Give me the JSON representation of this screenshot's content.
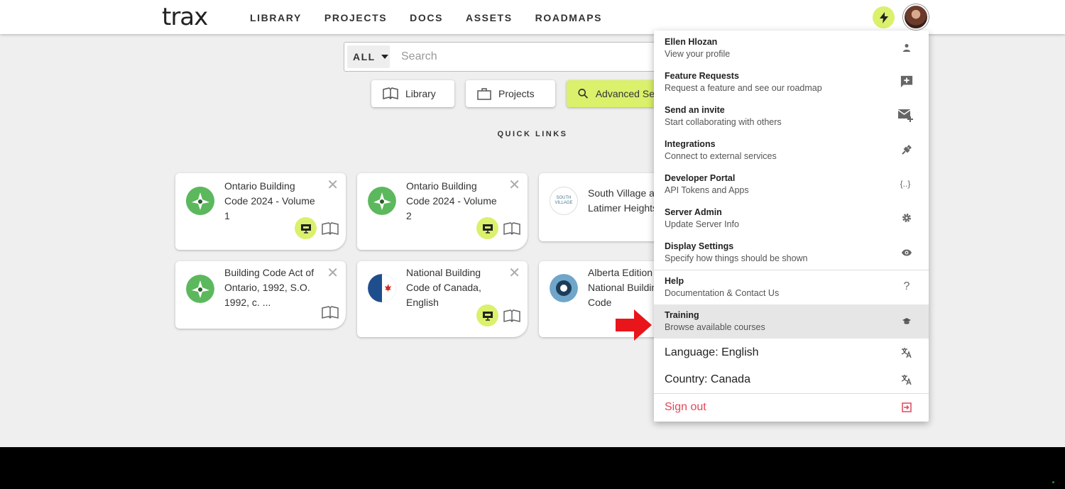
{
  "brand": {
    "logo": "trax",
    "accent": "#dbf06b",
    "danger": "#e2475b"
  },
  "nav": [
    "LIBRARY",
    "PROJECTS",
    "DOCS",
    "ASSETS",
    "ROADMAPS"
  ],
  "search": {
    "scope": "ALL",
    "placeholder": "Search"
  },
  "pills": {
    "library": "Library",
    "projects": "Projects",
    "advanced": "Advanced Se"
  },
  "quick_links_label": "QUICK LINKS",
  "cards": [
    {
      "title": "Ontario Building Code 2024 - Volume 1",
      "thumb": "trillium-logo"
    },
    {
      "title": "Ontario Building Code 2024 - Volume 2",
      "thumb": "trillium-logo"
    },
    {
      "title": "South Village at Latimer Heights",
      "thumb": "south-village-logo",
      "thumb_text": "SOUTH VILLAGE"
    },
    {
      "title": "Building Code Act of Ontario, 1992, S.O. 1992, c. ...",
      "thumb": "trillium-logo"
    },
    {
      "title": "National Building Code of Canada, English",
      "thumb": "canada-flag"
    },
    {
      "title": "Alberta Edition of National Building Code",
      "thumb": "alberta-rose"
    }
  ],
  "menu": {
    "profile": {
      "title": "Ellen Hlozan",
      "sub": "View your profile"
    },
    "feature": {
      "title": "Feature Requests",
      "sub": "Request a feature and see our roadmap"
    },
    "invite": {
      "title": "Send an invite",
      "sub": "Start collaborating with others"
    },
    "integrations": {
      "title": "Integrations",
      "sub": "Connect to external services"
    },
    "developer": {
      "title": "Developer Portal",
      "sub": "API Tokens and Apps",
      "icon_text": "{..}"
    },
    "server": {
      "title": "Server Admin",
      "sub": "Update Server Info"
    },
    "display": {
      "title": "Display Settings",
      "sub": "Specify how things should be shown"
    },
    "help": {
      "title": "Help",
      "sub": "Documentation & Contact Us",
      "icon_text": "?"
    },
    "training": {
      "title": "Training",
      "sub": "Browse available courses"
    },
    "language": {
      "title": "Language: English"
    },
    "country": {
      "title": "Country: Canada"
    },
    "signout": {
      "title": "Sign out"
    }
  }
}
